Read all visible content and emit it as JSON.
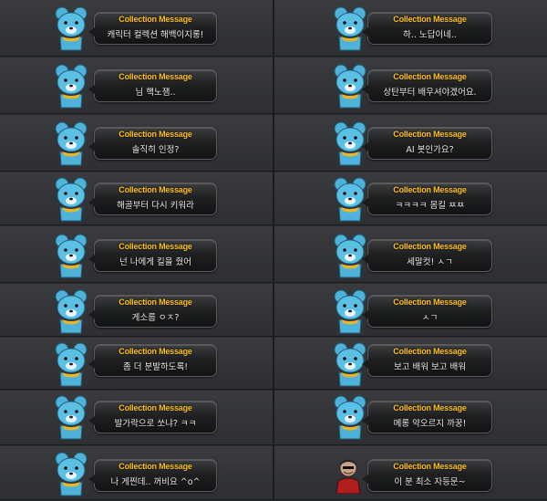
{
  "bubble_title": "Collection Message",
  "colors": {
    "title": "#ffc21a",
    "bear": "#4fb3d9",
    "text": "#e9e9e9"
  },
  "rows": [
    {
      "left": {
        "text": "캐릭터 컬렉션 해백이지롱!",
        "icon": "bear-icon"
      },
      "right": {
        "text": "하.. 노답이네..",
        "icon": "bear-icon"
      }
    },
    {
      "left": {
        "text": "님 핵노잼..",
        "icon": "bear-icon"
      },
      "right": {
        "text": "상탄부터 배우셔야겠어요.",
        "icon": "bear-icon"
      }
    },
    {
      "left": {
        "text": "솔직히 인정?",
        "icon": "bear-icon"
      },
      "right": {
        "text": "AI 봇인가요?",
        "icon": "bear-icon"
      }
    },
    {
      "left": {
        "text": "해골부터 다시 키워라",
        "icon": "bear-icon"
      },
      "right": {
        "text": "ㅋㅋㅋㅋ 몸킬 ㅉㅉ",
        "icon": "bear-icon"
      }
    },
    {
      "left": {
        "text": "넌 나에게 킬을 줬어",
        "icon": "bear-icon"
      },
      "right": {
        "text": "세말컷! ㅅㄱ",
        "icon": "bear-icon"
      }
    },
    {
      "left": {
        "text": "게소름 ㅇㅈ?",
        "icon": "bear-icon"
      },
      "right": {
        "text": "ㅅㄱ",
        "icon": "bear-icon"
      }
    },
    {
      "left": {
        "text": "좀 더 분발하도록!",
        "icon": "bear-icon"
      },
      "right": {
        "text": "보고 배워 보고 배워",
        "icon": "bear-icon"
      }
    },
    {
      "left": {
        "text": "발가락으로 쏘냐? ㅋㅋ",
        "icon": "bear-icon"
      },
      "right": {
        "text": "메롱 약오르지 까꿍!",
        "icon": "bear-icon"
      }
    },
    {
      "left": {
        "text": "나 게찐데.. 꺼비요 ^o^",
        "icon": "bear-icon"
      },
      "right": {
        "text": "이 분 최소 자등문~",
        "icon": "person-icon"
      }
    }
  ]
}
